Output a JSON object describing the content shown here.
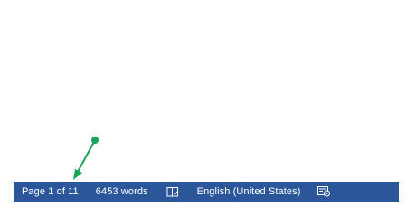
{
  "status_bar": {
    "page_info": "Page 1 of 11",
    "word_count": "6453 words",
    "proofing_icon": "book-proofing-icon",
    "language": "English (United States)",
    "track_changes_icon": "track-changes-icon",
    "background_color": "#2b579a",
    "text_color": "#ffffff"
  },
  "annotation": {
    "arrow_color": "#1aa15a",
    "arrow_icon": "green-pointer-arrow"
  }
}
